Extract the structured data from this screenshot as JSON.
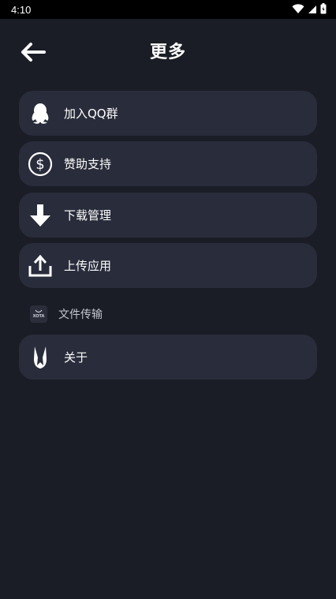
{
  "status_bar": {
    "time": "4:10",
    "icons": [
      "wifi-icon",
      "signal-icon",
      "battery-icon"
    ]
  },
  "header": {
    "title": "更多",
    "back_icon": "arrow-left-icon"
  },
  "menu": {
    "items": [
      {
        "label": "加入QQ群",
        "icon": "qq-penguin-icon"
      },
      {
        "label": "赞助支持",
        "icon": "dollar-circle-icon"
      },
      {
        "label": "下载管理",
        "icon": "download-arrow-icon"
      },
      {
        "label": "上传应用",
        "icon": "upload-icon"
      },
      {
        "label": "文件传输",
        "icon": "xota-app-icon",
        "icon_text": "XOTA"
      },
      {
        "label": "关于",
        "icon": "about-logo-icon"
      }
    ]
  },
  "colors": {
    "background": "#1b1d26",
    "card": "#292c3a",
    "status_bar": "#000000"
  }
}
